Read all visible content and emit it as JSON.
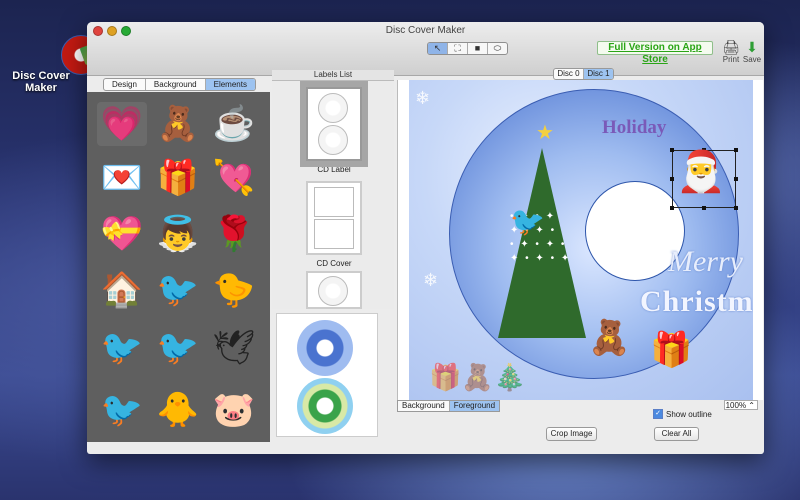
{
  "desktop": {
    "app_icon_label_line1": "Disc Cover",
    "app_icon_label_line2": "Maker"
  },
  "window": {
    "title": "Disc Cover Maker"
  },
  "toolbar": {
    "tools": [
      "arrow",
      "fit",
      "rect",
      "ellipse"
    ],
    "app_store_link": "Full Version on App Store",
    "print_label": "Print",
    "save_label": "Save"
  },
  "left_panel": {
    "tabs": [
      "Design",
      "Background",
      "Elements"
    ],
    "active_tab": "Elements",
    "elements": [
      {
        "icon": "heart-icon",
        "glyph": "💗"
      },
      {
        "icon": "teddy-bear-icon",
        "glyph": "🧸"
      },
      {
        "icon": "coffee-cup-icon",
        "glyph": "☕"
      },
      {
        "icon": "love-note-icon",
        "glyph": "💌"
      },
      {
        "icon": "gift-icon",
        "glyph": "🎁"
      },
      {
        "icon": "heart-arrow-icon",
        "glyph": "💘"
      },
      {
        "icon": "winged-heart-icon",
        "glyph": "💝"
      },
      {
        "icon": "cupid-icon",
        "glyph": "👼"
      },
      {
        "icon": "rose-icon",
        "glyph": "🌹"
      },
      {
        "icon": "house-icon",
        "glyph": "🏠"
      },
      {
        "icon": "red-bird-icon",
        "glyph": "🐦"
      },
      {
        "icon": "yellow-bird-icon",
        "glyph": "🐤"
      },
      {
        "icon": "black-bird-icon",
        "glyph": "🐦"
      },
      {
        "icon": "brown-bird-icon",
        "glyph": "🐦"
      },
      {
        "icon": "flying-bird-icon",
        "glyph": "🕊"
      },
      {
        "icon": "blue-bird-icon",
        "glyph": "🐦"
      },
      {
        "icon": "green-bird-icon",
        "glyph": "🐥"
      },
      {
        "icon": "pig-icon",
        "glyph": "🐷"
      }
    ]
  },
  "labels_list": {
    "header": "Labels List",
    "items": [
      {
        "name": "CD Label"
      },
      {
        "name": "CD Cover"
      }
    ]
  },
  "canvas": {
    "disc_tabs": [
      "Disc 0",
      "Disc 1"
    ],
    "active_disc": "Disc 1",
    "headline": "Holiday",
    "merry": "Merry",
    "christmas": "Christmas",
    "layer_tabs": [
      "Background",
      "Foreground"
    ],
    "active_layer": "Foreground",
    "zoom": "100%",
    "show_outline_label": "Show outline",
    "show_outline_checked": true,
    "crop_button": "Crop Image",
    "clear_button": "Clear All"
  }
}
